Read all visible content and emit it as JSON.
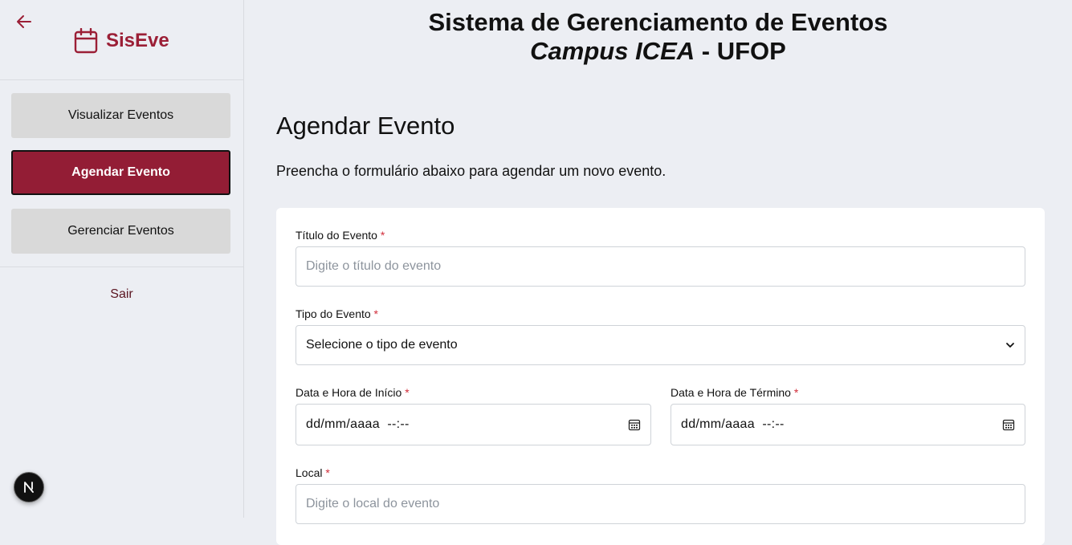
{
  "colors": {
    "brand": "#9b1f36",
    "active_nav": "#931d35",
    "required": "#d12d3a",
    "background": "#eceef3"
  },
  "sidebar": {
    "back_icon": "arrow-left-icon",
    "brand_icon": "calendar-icon",
    "brand_name": "SisEve",
    "items": [
      {
        "label": "Visualizar Eventos",
        "active": false
      },
      {
        "label": "Agendar Evento",
        "active": true
      },
      {
        "label": "Gerenciar Eventos",
        "active": false
      }
    ],
    "logout_label": "Sair",
    "badge_letter": "N"
  },
  "header": {
    "line1": "Sistema de Gerenciamento de Eventos",
    "campus": "Campus ICEA",
    "separator": " - ",
    "institution": "UFOP"
  },
  "main": {
    "title": "Agendar Evento",
    "subtitle": "Preencha o formulário abaixo para agendar um novo evento."
  },
  "form": {
    "required_mark": "*",
    "titulo": {
      "label": "Título do Evento",
      "placeholder": "Digite o título do evento"
    },
    "tipo": {
      "label": "Tipo do Evento",
      "selected": "Selecione o tipo de evento"
    },
    "inicio": {
      "label": "Data e Hora de Início",
      "value": "dd/mm/aaaa  --:--"
    },
    "termino": {
      "label": "Data e Hora de Término",
      "value": "dd/mm/aaaa  --:--"
    },
    "local": {
      "label": "Local",
      "placeholder": "Digite o local do evento"
    }
  }
}
